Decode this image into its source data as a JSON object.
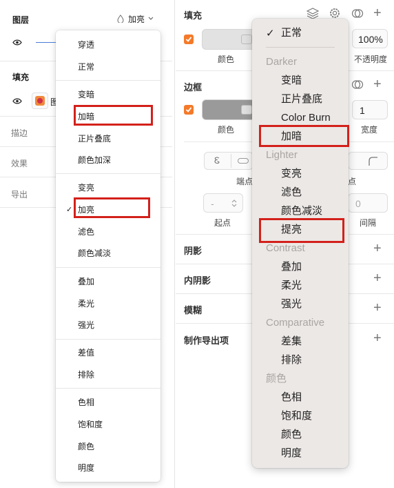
{
  "left_panel": {
    "layers_title": "图层",
    "blend_mode_value": "加亮",
    "fill_title": "填充",
    "fill_layer_name": "图",
    "sections": [
      "描边",
      "效果",
      "导出"
    ]
  },
  "left_dropdown": {
    "groups": [
      [
        "穿透",
        "正常"
      ],
      [
        "变暗",
        "加暗",
        "正片叠底",
        "颜色加深"
      ],
      [
        "变亮",
        "加亮",
        "滤色",
        "颜色减淡"
      ],
      [
        "叠加",
        "柔光",
        "强光"
      ],
      [
        "差值",
        "排除"
      ],
      [
        "色相",
        "饱和度",
        "颜色",
        "明度"
      ]
    ],
    "checked": "加亮"
  },
  "right_panel": {
    "fill_title": "填充",
    "fill_color_label": "颜色",
    "fill_opacity_value": "100%",
    "fill_opacity_label": "不透明度",
    "border_title": "边框",
    "border_color_label": "颜色",
    "border_width_value": "1",
    "border_width_label": "宽度",
    "endpoint_label_left": "端点",
    "endpoint_label_right": "点",
    "start_label": "起点",
    "start_value": "-",
    "gap_value": "0",
    "gap_label": "间隔",
    "sections": [
      "阴影",
      "内阴影",
      "模糊",
      "制作导出项"
    ]
  },
  "right_dropdown": {
    "checked_label": "正常",
    "groups": [
      {
        "heading": "Darker",
        "items": [
          "变暗",
          "正片叠底",
          "Color Burn",
          "加暗"
        ]
      },
      {
        "heading": "Lighter",
        "items": [
          "变亮",
          "滤色",
          "颜色减淡",
          "提亮"
        ]
      },
      {
        "heading": "Contrast",
        "items": [
          "叠加",
          "柔光",
          "强光"
        ]
      },
      {
        "heading": "Comparative",
        "items": [
          "差集",
          "排除"
        ]
      },
      {
        "heading": "颜色",
        "items": [
          "色相",
          "饱和度",
          "颜色",
          "明度"
        ]
      }
    ]
  },
  "colors": {
    "accent_orange": "#f47a2a",
    "highlight_red": "#d3201a",
    "menu_bg": "#ece8e6"
  }
}
